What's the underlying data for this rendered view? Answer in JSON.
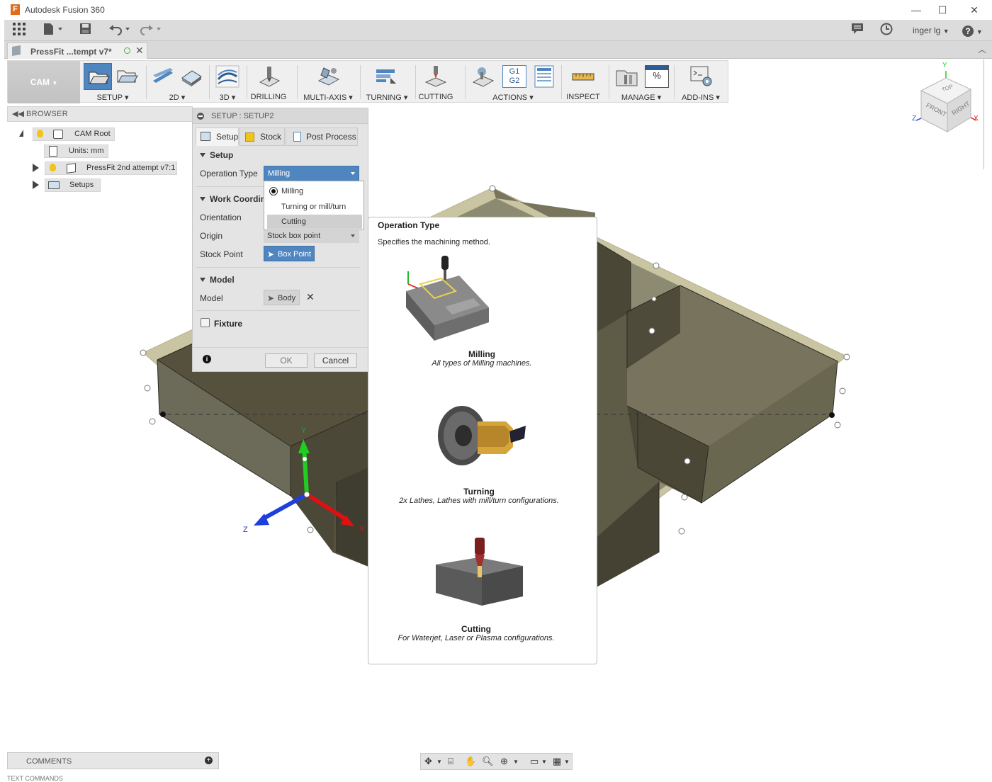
{
  "window": {
    "title": "Autodesk Fusion 360",
    "minimize": "—",
    "maximize": "☐",
    "close": "✕"
  },
  "quick_access": {
    "user": "inger lg",
    "help": "?"
  },
  "document_tab": {
    "name": "PressFit ...tempt v7*"
  },
  "toolbar": {
    "workspace": "CAM",
    "groups": [
      {
        "label": "SETUP ▾"
      },
      {
        "label": "2D ▾"
      },
      {
        "label": "3D ▾"
      },
      {
        "label": "DRILLING"
      },
      {
        "label": "MULTI-AXIS ▾"
      },
      {
        "label": "TURNING ▾"
      },
      {
        "label": "CUTTING"
      },
      {
        "label": "ACTIONS ▾"
      },
      {
        "label": "INSPECT"
      },
      {
        "label": "MANAGE ▾"
      },
      {
        "label": "ADD-INS ▾"
      }
    ],
    "g1g2": [
      "G1",
      "G2"
    ]
  },
  "browser": {
    "title": "BROWSER",
    "items": [
      {
        "label": "CAM Root"
      },
      {
        "label": "Units: mm"
      },
      {
        "label": "PressFit 2nd attempt v7:1"
      },
      {
        "label": "Setups"
      }
    ]
  },
  "setup_dialog": {
    "title": "SETUP : SETUP2",
    "tabs": [
      {
        "label": "Setup"
      },
      {
        "label": "Stock"
      },
      {
        "label": "Post Process"
      }
    ],
    "section_setup": "Setup",
    "operation_type_label": "Operation Type",
    "operation_type_value": "Milling",
    "operation_options": [
      "Milling",
      "Turning or mill/turn",
      "Cutting"
    ],
    "section_wcs": "Work Coordin",
    "orientation_label": "Orientation",
    "origin_label": "Origin",
    "origin_value": "Stock box point",
    "stock_point_label": "Stock Point",
    "stock_point_value": "Box Point",
    "section_model": "Model",
    "model_label": "Model",
    "model_value": "Body",
    "fixture_label": "Fixture",
    "ok": "OK",
    "cancel": "Cancel"
  },
  "tooltip": {
    "title": "Operation Type",
    "description": "Specifies the machining method.",
    "items": [
      {
        "name": "Milling",
        "desc": "All types of Milling machines."
      },
      {
        "name": "Turning",
        "desc": "2x Lathes, Lathes with mill/turn configurations."
      },
      {
        "name": "Cutting",
        "desc": "For Waterjet, Laser or Plasma configurations."
      }
    ]
  },
  "viewcube": {
    "top": "TOP",
    "front": "FRONT",
    "right": "RIGHT",
    "y": "Y",
    "z": "Z",
    "x": "X"
  },
  "triad": {
    "y": "Y",
    "z": "Z",
    "x": "X"
  },
  "comments": {
    "label": "COMMENTS"
  },
  "text_commands": {
    "label": "TEXT COMMANDS"
  }
}
